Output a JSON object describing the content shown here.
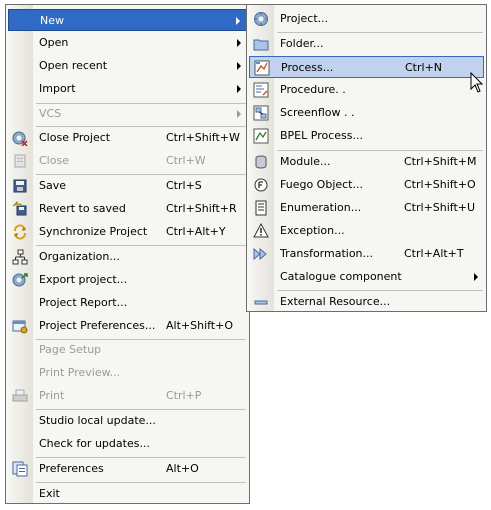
{
  "main_menu": {
    "items": [
      {
        "label": "New",
        "shortcut": ""
      },
      {
        "label": "Open",
        "shortcut": ""
      },
      {
        "label": "Open recent",
        "shortcut": ""
      },
      {
        "label": "Import",
        "shortcut": ""
      },
      {
        "label": "VCS",
        "shortcut": ""
      },
      {
        "label": "Close Project",
        "shortcut": "Ctrl+Shift+W"
      },
      {
        "label": "Close",
        "shortcut": "Ctrl+W"
      },
      {
        "label": "Save",
        "shortcut": "Ctrl+S"
      },
      {
        "label": "Revert to saved",
        "shortcut": "Ctrl+Shift+R"
      },
      {
        "label": "Synchronize Project",
        "shortcut": "Ctrl+Alt+Y"
      },
      {
        "label": "Organization...",
        "shortcut": ""
      },
      {
        "label": "Export project...",
        "shortcut": ""
      },
      {
        "label": "Project Report...",
        "shortcut": ""
      },
      {
        "label": "Project Preferences...",
        "shortcut": "Alt+Shift+O"
      },
      {
        "label": "Page Setup",
        "shortcut": ""
      },
      {
        "label": "Print Preview...",
        "shortcut": ""
      },
      {
        "label": "Print",
        "shortcut": "Ctrl+P"
      },
      {
        "label": "Studio local update...",
        "shortcut": ""
      },
      {
        "label": "Check for updates...",
        "shortcut": ""
      },
      {
        "label": "Preferences",
        "shortcut": "Alt+O"
      },
      {
        "label": "Exit",
        "shortcut": ""
      }
    ]
  },
  "new_submenu": {
    "items": [
      {
        "label": "Project...",
        "shortcut": ""
      },
      {
        "label": "Folder...",
        "shortcut": ""
      },
      {
        "label": "Process...",
        "shortcut": "Ctrl+N"
      },
      {
        "label": "Procedure. .",
        "shortcut": ""
      },
      {
        "label": "Screenflow . .",
        "shortcut": ""
      },
      {
        "label": "BPEL Process...",
        "shortcut": ""
      },
      {
        "label": "Module...",
        "shortcut": "Ctrl+Shift+M"
      },
      {
        "label": "Fuego Object...",
        "shortcut": "Ctrl+Shift+O"
      },
      {
        "label": "Enumeration...",
        "shortcut": "Ctrl+Shift+U"
      },
      {
        "label": "Exception...",
        "shortcut": ""
      },
      {
        "label": "Transformation...",
        "shortcut": "Ctrl+Alt+T"
      },
      {
        "label": "Catalogue component",
        "shortcut": ""
      },
      {
        "label": "External Resource...",
        "shortcut": ""
      }
    ]
  },
  "colors": {
    "menu_background": "#f6f6f3",
    "highlight_main": "#316ac5",
    "highlight_sub": "#c1d2ee",
    "disabled_text": "#9a9a9a"
  }
}
